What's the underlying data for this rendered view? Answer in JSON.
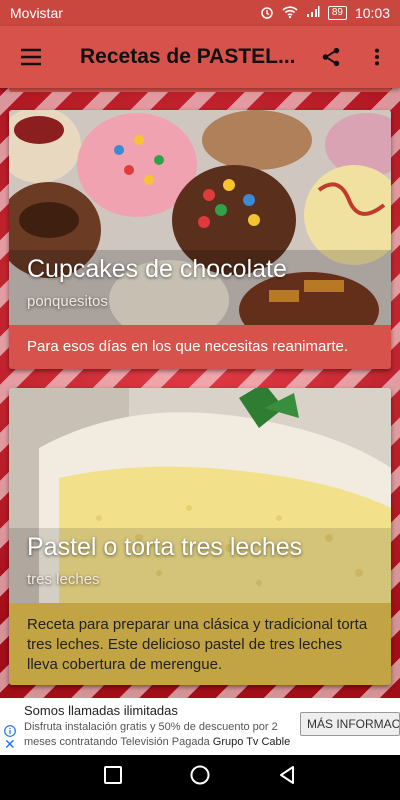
{
  "status_bar": {
    "carrier": "Movistar",
    "battery": "89",
    "time": "10:03"
  },
  "app_bar": {
    "title": "Recetas de PASTEL..."
  },
  "cards": [
    {
      "title": "Cupcakes de chocolate",
      "subtitle": "ponquesitos",
      "description": "Para esos días en los que necesitas reanimarte.",
      "color": "#d6524a"
    },
    {
      "title": "Pastel o torta tres leches",
      "subtitle": "tres leches",
      "description": "Receta para preparar una clásica y tradicional torta tres leches. Este delicioso pastel de tres leches lleva cobertura de merengue.",
      "color": "#c2a445"
    }
  ],
  "ad": {
    "title": "Somos llamadas ilimitadas",
    "body_prefix": "Disfruta instalación gratis y 50% de descuento por 2 meses contratando Televisión Pagada ",
    "body_brand": "Grupo Tv Cable",
    "cta": "MÁS INFORMACIÓN"
  },
  "icons": {
    "menu": "menu-icon",
    "share": "share-icon",
    "more": "more-vert-icon",
    "alarm": "alarm-icon",
    "wifi": "wifi-icon",
    "signal": "signal-icon",
    "nav_recent": "square-icon",
    "nav_home": "circle-icon",
    "nav_back": "triangle-back-icon"
  },
  "colors": {
    "primary": "#d6524a",
    "status_bar": "#c9473f",
    "card2_accent": "#c2a445"
  }
}
